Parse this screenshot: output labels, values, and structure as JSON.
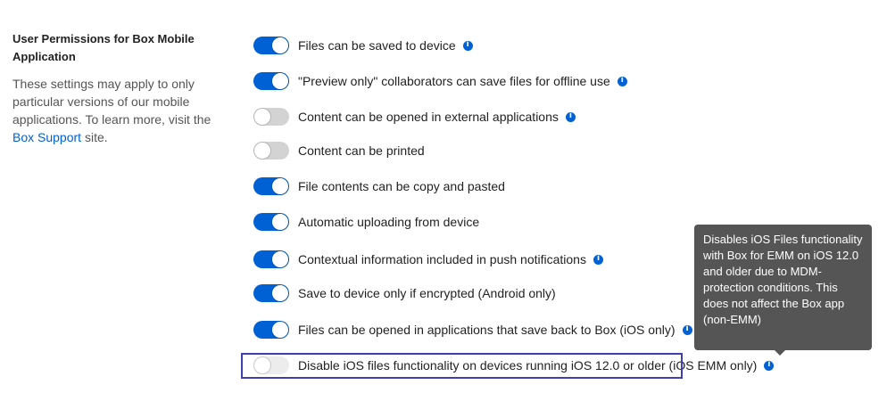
{
  "section": {
    "title": "User Permissions for Box Mobile Application",
    "description_prefix": "These settings may apply to only particular versions of our mobile applications. To learn more, visit the ",
    "link_text": "Box Support",
    "description_suffix": " site."
  },
  "settings": [
    {
      "label": "Files can be saved to device",
      "state": "on",
      "info": true
    },
    {
      "label": "\"Preview only\" collaborators can save files for offline use",
      "state": "on",
      "info": true
    },
    {
      "label": "Content can be opened in external applications",
      "state": "off",
      "info": true
    },
    {
      "label": "Content can be printed",
      "state": "off",
      "info": false
    },
    {
      "label": "File contents can be copy and pasted",
      "state": "on",
      "info": false
    },
    {
      "label": "Automatic uploading from device",
      "state": "on",
      "info": false
    },
    {
      "label": "Contextual information included in push notifications",
      "state": "on",
      "info": true
    },
    {
      "label": "Save to device only if encrypted (Android only)",
      "state": "on",
      "info": false
    },
    {
      "label": "Files can be opened in applications that save back to Box (iOS only)",
      "state": "on",
      "info": true
    },
    {
      "label": "Disable iOS files functionality on devices running iOS 12.0 or older (iOS EMM only)",
      "state": "off-disabled",
      "info": true
    }
  ],
  "tooltip": {
    "text": "Disables iOS Files functionality with Box for EMM on iOS 12.0 and older due to MDM-protection conditions. This does not affect the Box app (non-EMM)"
  },
  "colors": {
    "accent": "#0061d5",
    "toggle_off": "#d3d3d3",
    "tooltip_bg": "#555555",
    "focus_border": "#3f3fb0"
  }
}
